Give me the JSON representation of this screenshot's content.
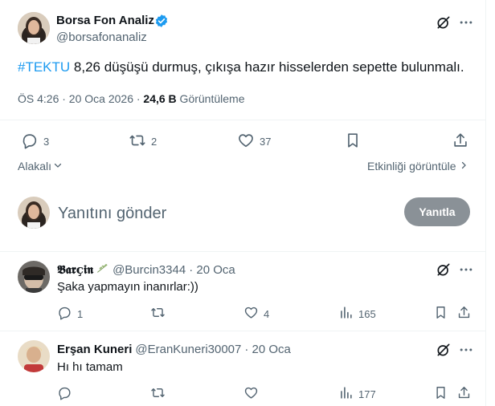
{
  "post": {
    "author_name": "Borsa Fon Analiz",
    "author_handle": "@borsafonanaliz",
    "hashtag": "#TEKTU",
    "body": " 8,26 düşüşü durmuş, çıkışa hazır hisselerden sepette bulunmalı.",
    "time": "ÖS 4:26 · 20 Oca 2026 · ",
    "views_count": "24,6 B",
    "views_label": " Görüntüleme",
    "replies": "3",
    "reposts": "2",
    "likes": "37",
    "sort_label": "Alakalı",
    "engagement_link": "Etkinliği görüntüle",
    "verified_color": "#1d9bf0",
    "hashtag_color": "#1d9bf0"
  },
  "composer": {
    "placeholder": "Yanıtını gönder",
    "reply_button": "Yanıtla"
  },
  "replies": [
    {
      "name": "𝕭𝖆𝖗ç𝖎𝖓",
      "handle": "@Burcin3344",
      "date": "· 20 Oca",
      "text": "Şaka yapmayın inanırlar:))",
      "replies": "1",
      "reposts": "",
      "likes": "4",
      "views": "165"
    },
    {
      "name": "Erşan Kuneri",
      "handle": "@EranKuneri30007",
      "date": "· 20 Oca",
      "text": "Hı hı tamam",
      "replies": "",
      "reposts": "",
      "likes": "",
      "views": "177"
    }
  ]
}
